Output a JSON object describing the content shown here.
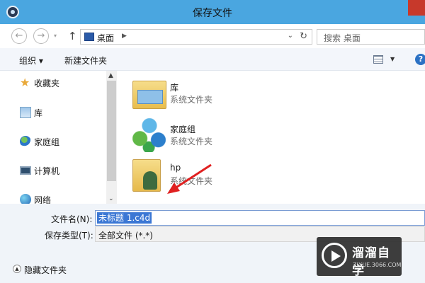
{
  "window": {
    "title": "保存文件",
    "close_icon": "close-icon"
  },
  "address": {
    "back_icon": "back-arrow-icon",
    "forward_icon": "forward-arrow-icon",
    "up_icon": "up-arrow-icon",
    "path_segment": "桌面",
    "search_placeholder": "搜索 桌面"
  },
  "toolbar": {
    "organize_label": "组织 ▾",
    "new_folder_label": "新建文件夹"
  },
  "sidebar": {
    "items": [
      {
        "label": "收藏夹",
        "icon": "favorites-star-icon"
      },
      {
        "label": "库",
        "icon": "library-icon"
      },
      {
        "label": "家庭组",
        "icon": "homegroup-icon"
      },
      {
        "label": "计算机",
        "icon": "computer-icon"
      },
      {
        "label": "网络",
        "icon": "network-icon"
      }
    ]
  },
  "files": [
    {
      "name": "库",
      "type": "系统文件夹",
      "icon": "library-folder-icon"
    },
    {
      "name": "家庭组",
      "type": "系统文件夹",
      "icon": "homegroup-icon"
    },
    {
      "name": "hp",
      "type": "系统文件夹",
      "icon": "user-folder-icon"
    }
  ],
  "save_form": {
    "filename_label": "文件名(N):",
    "filename_value": "未标题 1.c4d",
    "filetype_label": "保存类型(T):",
    "filetype_value": "全部文件 (*.*)",
    "hide_folders_label": "隐藏文件夹"
  },
  "watermark": {
    "title": "溜溜自学",
    "subtitle": "ZIXUE.3066.COM"
  },
  "colors": {
    "titlebar": "#4aa6e0",
    "close": "#c7392b",
    "selection": "#3b77d4",
    "arrow": "#e02020"
  }
}
